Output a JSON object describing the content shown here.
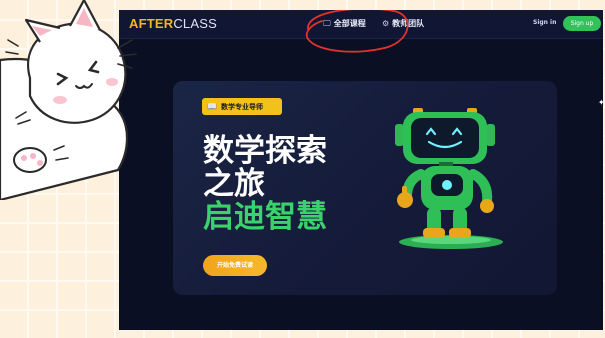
{
  "app": {
    "logo_strong": "AFTER",
    "logo_light": "CLASS"
  },
  "nav": {
    "items": [
      {
        "label": "全部课程",
        "icon": "monitor-icon"
      },
      {
        "label": "教师团队",
        "icon": "users-icon"
      }
    ],
    "signin_label": "Sign in",
    "signup_label": "Sign up"
  },
  "hero": {
    "tag_label": "数学专业导师",
    "tag_icon": "book-icon",
    "headline_line1": "数学探索",
    "headline_line2": "之旅",
    "headline_line3": "启迪智慧",
    "cta_label": "开始免费试读"
  },
  "colors": {
    "accent_yellow": "#f5b51e",
    "accent_green": "#3ad26a",
    "cta_orange": "#f0a41c",
    "background_dark": "#0b0f24",
    "annotation_red": "#e0332d"
  }
}
